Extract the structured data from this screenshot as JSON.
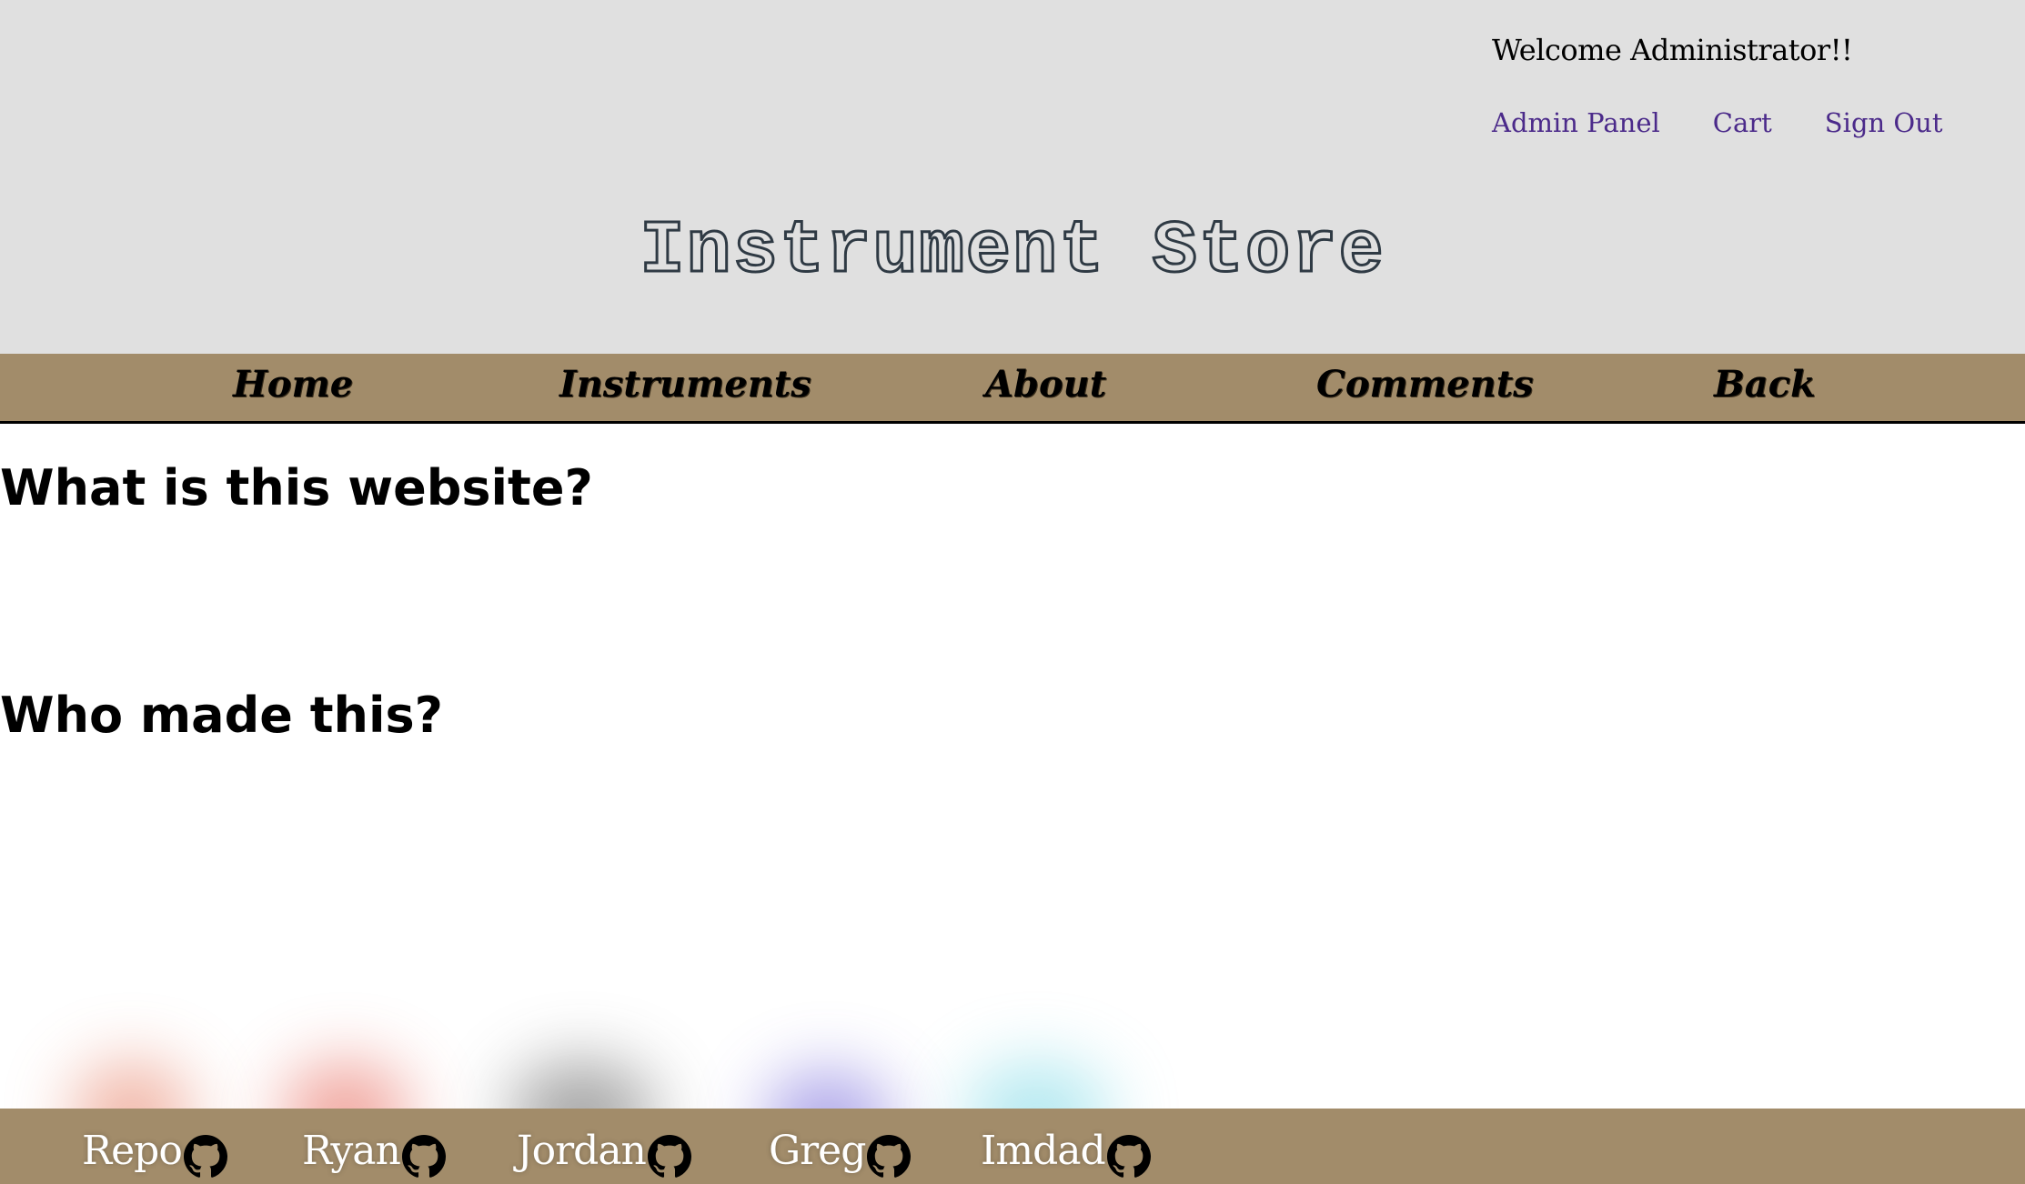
{
  "header": {
    "welcome": "Welcome Administrator!!",
    "links": [
      "Admin Panel",
      "Cart",
      "Sign Out"
    ],
    "title": "Instrument Store"
  },
  "nav": {
    "items": [
      "Home",
      "Instruments",
      "About",
      "Comments",
      "Back"
    ]
  },
  "main": {
    "heading1": "What is this website?",
    "heading2": "Who made this?"
  },
  "footer": {
    "links": [
      {
        "label": "Repo",
        "icon": "github-icon",
        "glow": "#e06040"
      },
      {
        "label": "Ryan",
        "icon": "github-icon",
        "glow": "#e04030"
      },
      {
        "label": "Jordan",
        "icon": "github-icon",
        "glow": "#404040"
      },
      {
        "label": "Greg",
        "icon": "github-icon",
        "glow": "#5040d0"
      },
      {
        "label": "Imdad",
        "icon": "github-icon",
        "glow": "#60d0e0"
      }
    ]
  },
  "colors": {
    "header_bg": "#e0e0e0",
    "nav_bg": "#a28c6a",
    "link": "#4b2a8a"
  }
}
